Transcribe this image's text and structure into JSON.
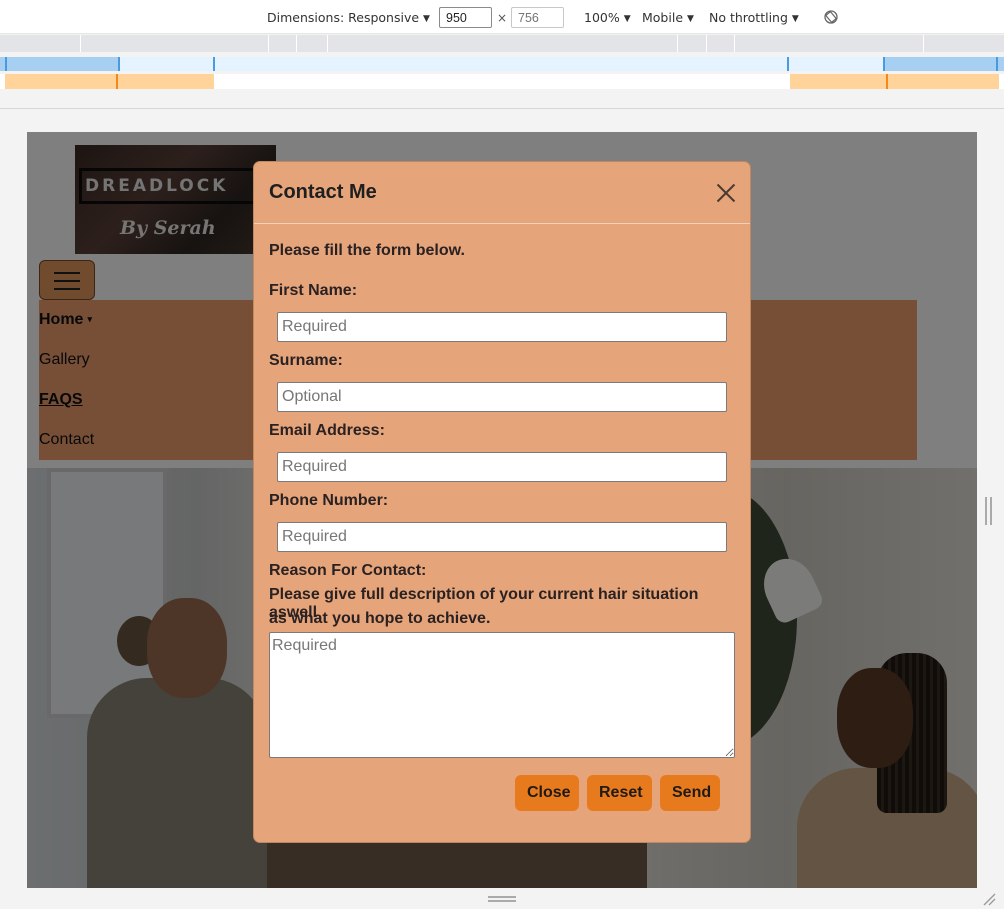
{
  "devtools": {
    "dimensions_label": "Dimensions: Responsive",
    "width_value": "950",
    "height_placeholder": "756",
    "times": "×",
    "zoom_label": "100%",
    "device_label": "Mobile",
    "throttling_label": "No throttling",
    "caret": "▼",
    "rotate_icon": "rotate-icon"
  },
  "site": {
    "logo_text": "DREADLOCK",
    "logo_subtext": "By Serah",
    "nav": {
      "items": [
        "Home",
        "Gallery",
        "FAQS",
        "Contact"
      ],
      "caret": "▾"
    }
  },
  "modal": {
    "title": "Contact Me",
    "intro": "Please fill the form below.",
    "first_name_label": "First Name:",
    "first_name_placeholder": "Required",
    "surname_label": "Surname:",
    "surname_placeholder": "Optional",
    "email_label": "Email Address:",
    "email_placeholder": "Required",
    "phone_label": "Phone Number:",
    "phone_placeholder": "Required",
    "reason_label": "Reason For Contact:",
    "reason_help_1": "Please give full description of your current hair situation aswell",
    "reason_help_2": "as what you hope to achieve.",
    "reason_placeholder": "Required",
    "buttons": {
      "close": "Close",
      "reset": "Reset",
      "send": "Send"
    }
  },
  "colors": {
    "modal_bg": "#e6a47b",
    "button_bg": "#e87a1e",
    "nav_bg": "#ee9e6e"
  }
}
